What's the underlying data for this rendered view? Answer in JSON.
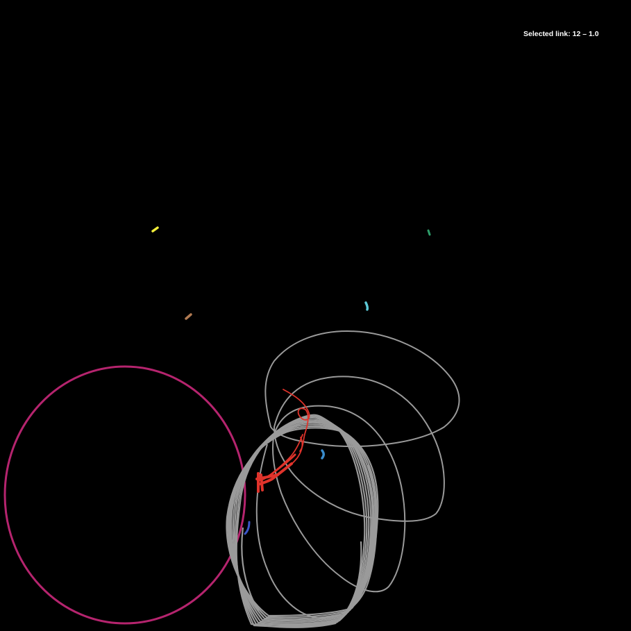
{
  "status": {
    "selected_link_text": "Selected link: 12 – 1.0"
  },
  "colors": {
    "background": "#000000",
    "text": "#ffffff",
    "large_circle": "#b5246e",
    "trajectory_gray": "#9a9a9a",
    "selected_link": "#e0332b",
    "marker_yellow": "#f2ee3a",
    "marker_green": "#2e9e6a",
    "marker_cyan": "#5cc8d6",
    "marker_brown": "#b07a52",
    "marker_blue": "#3a8ccc",
    "marker_navy": "#3c56c8"
  },
  "markers": [
    {
      "name": "yellow",
      "color_key": "marker_yellow"
    },
    {
      "name": "green",
      "color_key": "marker_green"
    },
    {
      "name": "cyan",
      "color_key": "marker_cyan"
    },
    {
      "name": "brown",
      "color_key": "marker_brown"
    },
    {
      "name": "blue",
      "color_key": "marker_blue"
    },
    {
      "name": "navy",
      "color_key": "marker_navy"
    }
  ]
}
